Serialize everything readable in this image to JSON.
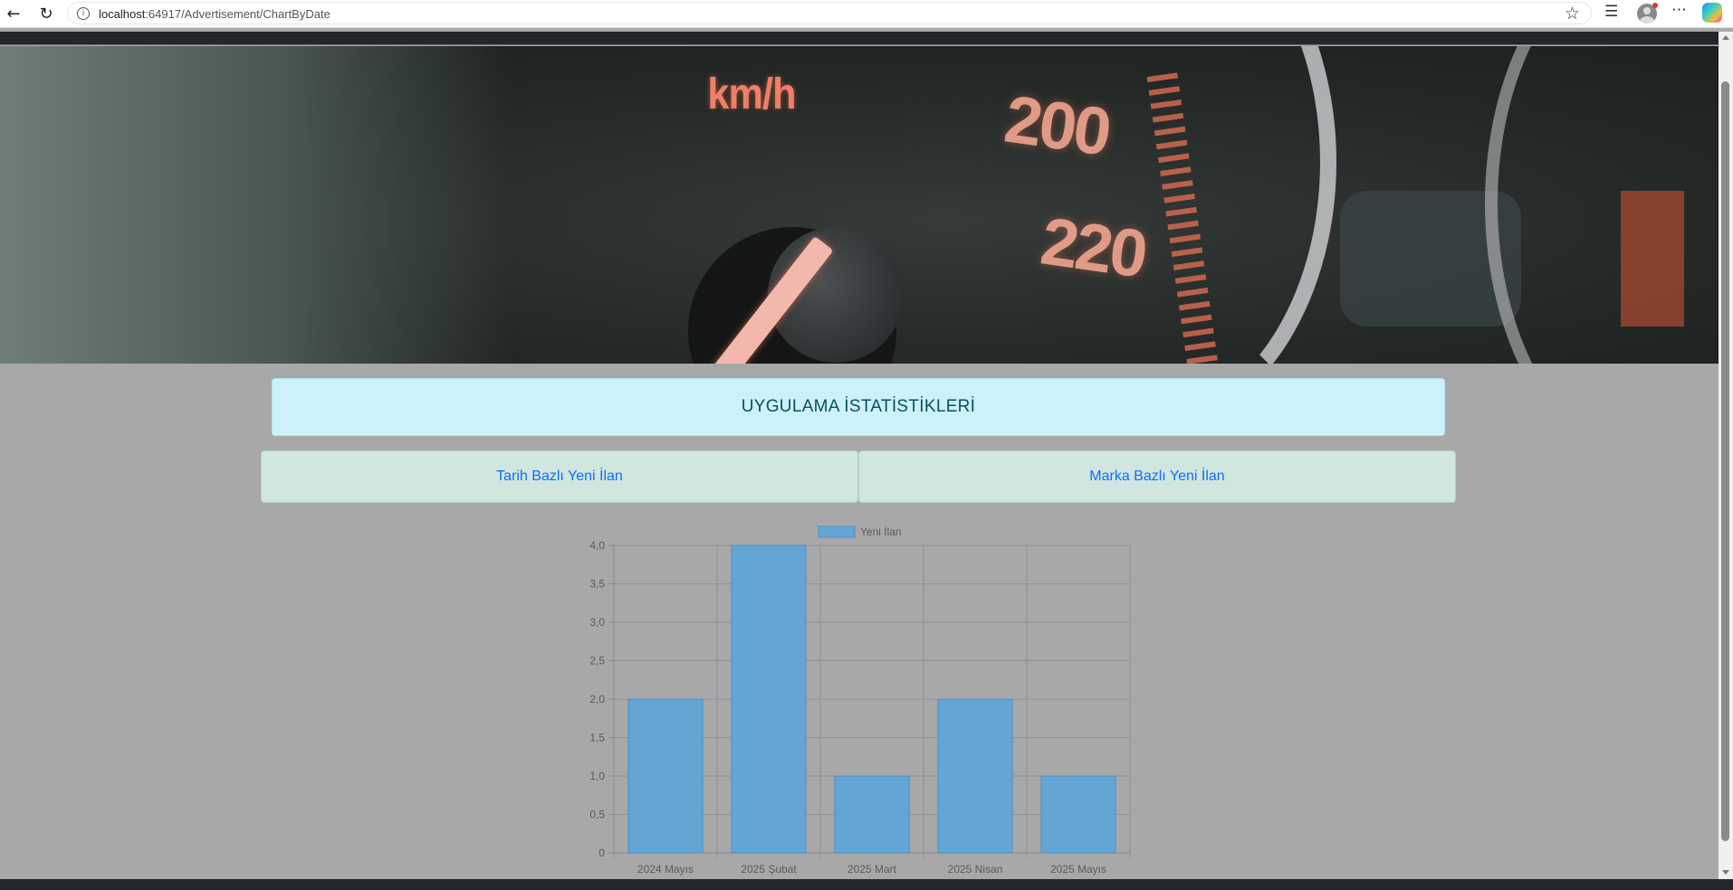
{
  "browser": {
    "url_host": "localhost",
    "url_rest": ":64917/Advertisement/ChartByDate",
    "icons": [
      "back-arrow-icon",
      "reload-icon",
      "info-icon",
      "star-icon",
      "favorites-icon",
      "profile-icon",
      "more-icon",
      "copilot-icon"
    ]
  },
  "page": {
    "header_title": "UYGULAMA İSTATİSTİKLERİ",
    "tabs": [
      {
        "label": "Tarih Bazlı Yeni İlan"
      },
      {
        "label": "Marka Bazlı Yeni İlan"
      }
    ]
  },
  "hero": {
    "text_unit": "km/h",
    "speed_a": "200",
    "speed_b": "220"
  },
  "colors": {
    "bar_fill": "#63a6d6",
    "bar_stroke": "#4a90c8",
    "header_bg": "#ccf1f8",
    "tab_bg": "#d1e6de",
    "link": "#0d6efd",
    "page_bg": "#a8a8a8"
  },
  "chart_data": {
    "type": "bar",
    "title": "",
    "xlabel": "",
    "ylabel": "",
    "categories": [
      "2024 Mayıs",
      "2025 Şubat",
      "2025 Mart",
      "2025 Nisan",
      "2025 Mayıs"
    ],
    "series": [
      {
        "name": "Yeni İlan",
        "values": [
          2,
          4,
          1,
          2,
          1
        ]
      }
    ],
    "ylim": [
      0,
      4
    ],
    "yticks": [
      "0",
      "0,5",
      "1,0",
      "1,5",
      "2,0",
      "2,5",
      "3,0",
      "3,5",
      "4,0"
    ],
    "ytick_values": [
      0,
      0.5,
      1,
      1.5,
      2,
      2.5,
      3,
      3.5,
      4
    ],
    "grid": true,
    "legend": "top-center"
  }
}
